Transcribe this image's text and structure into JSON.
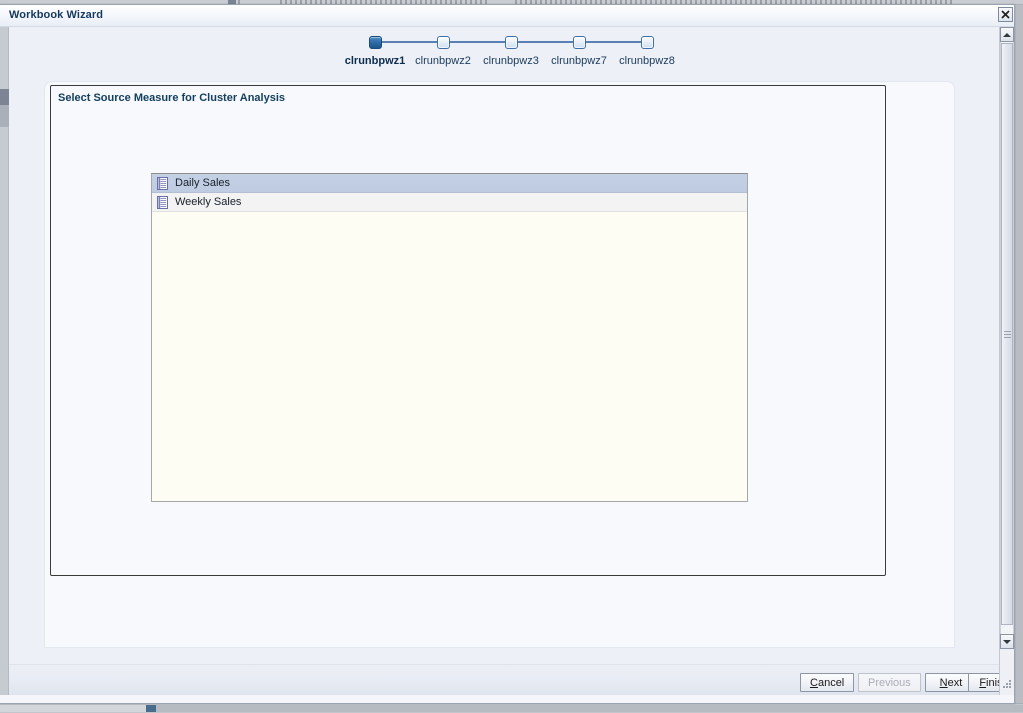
{
  "window": {
    "title": "Workbook Wizard",
    "close_icon": "close-icon"
  },
  "train": {
    "steps": [
      {
        "label": "clrunbpwz1",
        "active": true
      },
      {
        "label": "clrunbpwz2",
        "active": false
      },
      {
        "label": "clrunbpwz3",
        "active": false
      },
      {
        "label": "clrunbpwz7",
        "active": false
      },
      {
        "label": "clrunbpwz8",
        "active": false
      }
    ]
  },
  "groupbox": {
    "title": "Select Source Measure for Cluster Analysis"
  },
  "listbox": {
    "items": [
      {
        "label": "Daily Sales",
        "icon": "measure-document-icon",
        "selected": true
      },
      {
        "label": "Weekly Sales",
        "icon": "measure-document-icon",
        "selected": false
      }
    ]
  },
  "buttons": {
    "cancel": {
      "label": "Cancel",
      "mnemonic": "C",
      "disabled": false
    },
    "previous": {
      "label": "Previous",
      "mnemonic": "P",
      "disabled": true
    },
    "next": {
      "label": "Next",
      "mnemonic": "N",
      "disabled": false
    },
    "finish": {
      "label": "Finish",
      "mnemonic": "F",
      "disabled": false
    }
  },
  "scrollbar": {
    "up_icon": "scroll-up-arrow-icon",
    "down_icon": "scroll-down-arrow-icon"
  },
  "colors": {
    "title_text": "#15385e",
    "accent_blue": "#2f6ea8",
    "selection": "#c4d0e4",
    "listbox_bg": "#fdfdf3",
    "groupbox_border": "#3b3b3b"
  }
}
